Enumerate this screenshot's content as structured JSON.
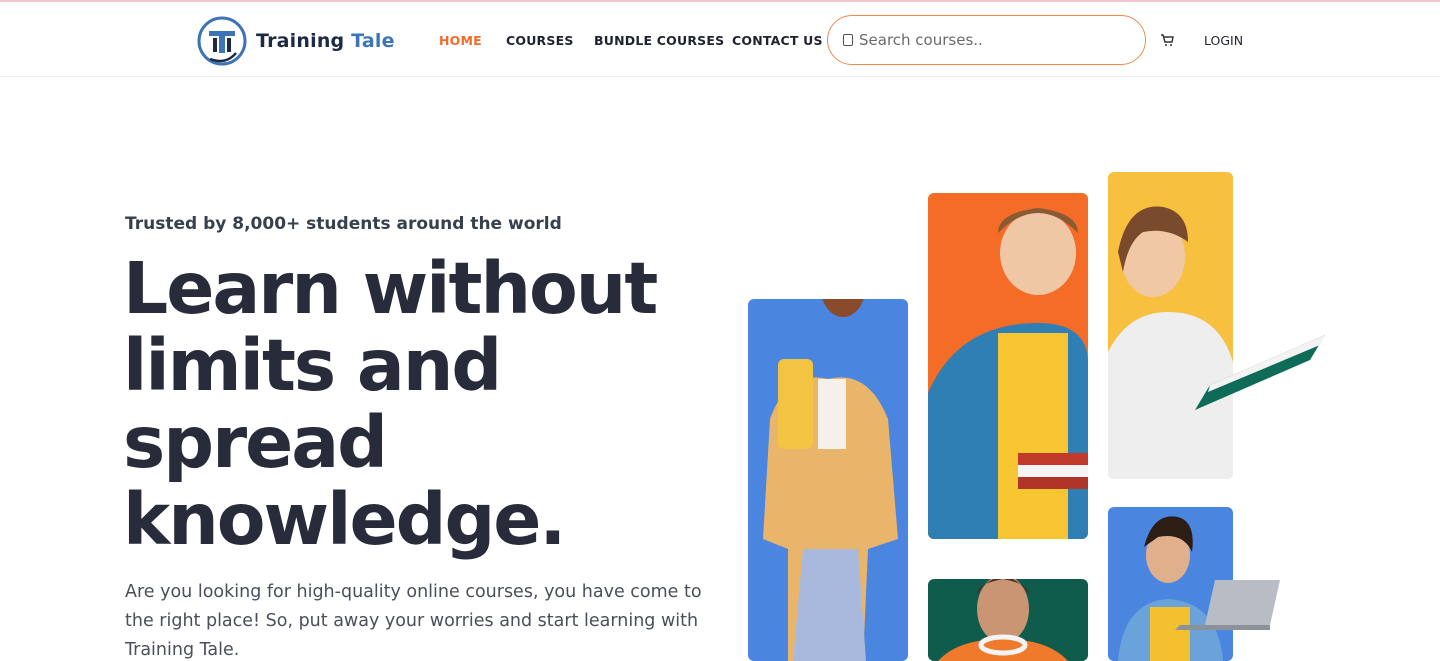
{
  "brand": {
    "name_part1": "Training",
    "name_part2": "Tale",
    "logo_letter": "T"
  },
  "nav": {
    "home": "HOME",
    "courses": "COURSES",
    "bundle": "BUNDLE COURSES",
    "contact": "CONTACT US",
    "login": "LOGIN"
  },
  "search": {
    "placeholder": "Search courses..",
    "value": ""
  },
  "icons": {
    "search": "search-icon",
    "cart": "cart-icon"
  },
  "hero": {
    "tagline": "Trusted by 8,000+ students around the world",
    "title": "Learn without limits and spread knowledge.",
    "description": "Are you looking for high-quality online courses, you have come to the right place! So, put away your worries and start learning with Training Tale."
  },
  "colors": {
    "accent": "#f26b2a",
    "brand_blue": "#3d74b8",
    "brand_navy": "#1d2a44",
    "photo_blue": "#4a86e0",
    "photo_orange": "#f46c26",
    "photo_yellow": "#f7c13f",
    "photo_green": "#0f5c4c"
  }
}
